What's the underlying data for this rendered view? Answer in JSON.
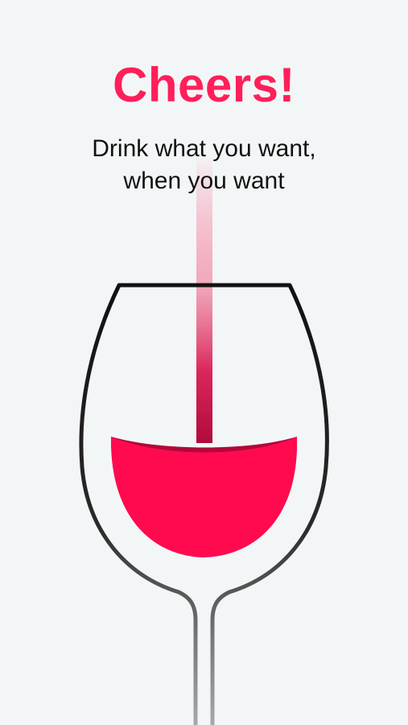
{
  "header": {
    "title": "Cheers!",
    "subtitle_line1": "Drink what you want,",
    "subtitle_line2": "when you want"
  },
  "illustration": {
    "icon": "wine-glass-icon",
    "pour_icon": "wine-pour-stream-icon"
  },
  "colors": {
    "accent": "#ff1f5a",
    "wine": "#ff0a4f",
    "background": "#f3f6f7",
    "glass_outline": "#111111",
    "text": "#111111"
  }
}
